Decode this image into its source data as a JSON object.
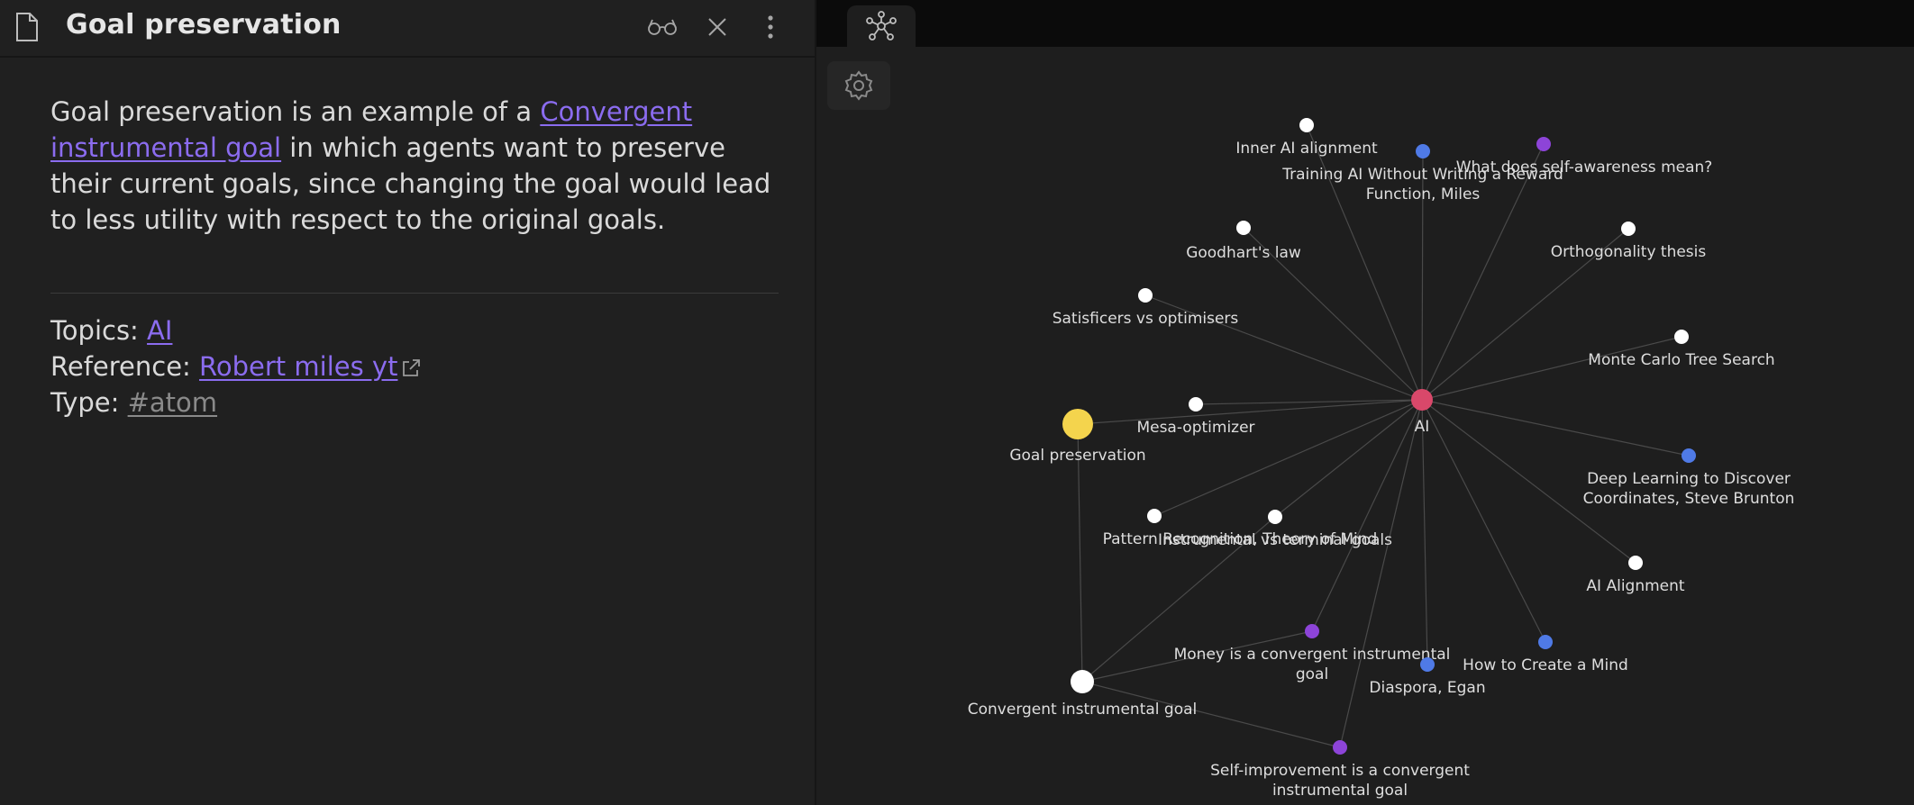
{
  "note": {
    "title": "Goal preservation",
    "header_icons": [
      "file-icon",
      "reading-view-icon",
      "close-icon",
      "more-options-icon"
    ],
    "paragraph": {
      "before_link": "Goal preservation is an example of a ",
      "link_line1": "Convergent ",
      "link_line2": "instrumental goal",
      "after_link": " in which agents want to preserve their current goals, since changing the goal would lead to less utility with respect to the original goals."
    },
    "topics_label": "Topics: ",
    "topics_link": "AI",
    "reference_label": "Reference: ",
    "reference_link": "Robert miles yt",
    "type_label": "Type: ",
    "type_tag": "#atom"
  },
  "graph": {
    "tab_icon": "graph-view-icon",
    "settings_icon": "gear-icon",
    "colors": {
      "background": "#1e1e1e",
      "edge": "#4a4a4a",
      "node_default": "#ffffff",
      "node_center": "#d9486a",
      "node_active": "#f4d44d",
      "node_blue": "#4f7ae6",
      "node_purple": "#8d44d8"
    },
    "nodes": [
      {
        "id": "ai",
        "label": "AI",
        "color": "node_center"
      },
      {
        "id": "goal-preservation",
        "label": "Goal preservation",
        "color": "node_active"
      },
      {
        "id": "convergent-instrumental-goal",
        "label": "Convergent instrumental goal",
        "color": "node_default"
      },
      {
        "id": "inner-ai-alignment",
        "label": "Inner AI alignment",
        "color": "node_default"
      },
      {
        "id": "training-ai-without-reward",
        "label_lines": [
          "Training AI Without Writing a Reward",
          "Function, Miles"
        ],
        "color": "node_blue"
      },
      {
        "id": "self-awareness",
        "label": "What does self-awareness mean?",
        "color": "node_purple"
      },
      {
        "id": "goodharts-law",
        "label": "Goodhart's law",
        "color": "node_default"
      },
      {
        "id": "orthogonality-thesis",
        "label": "Orthogonality thesis",
        "color": "node_default"
      },
      {
        "id": "satisficers",
        "label": "Satisficers vs optimisers",
        "color": "node_default"
      },
      {
        "id": "monte-carlo",
        "label": "Monte Carlo Tree Search",
        "color": "node_default"
      },
      {
        "id": "mesa-optimizer",
        "label": "Mesa-optimizer",
        "color": "node_default"
      },
      {
        "id": "deep-learning-coordinates",
        "label_lines": [
          "Deep Learning to Discover",
          "Coordinates, Steve Brunton"
        ],
        "color": "node_blue"
      },
      {
        "id": "pattern-recognition",
        "label": "Pattern Recognition, Theory of Mind",
        "color": "node_default"
      },
      {
        "id": "instrumental-terminal",
        "label": "Instrumental vs terminal goals",
        "color": "node_default"
      },
      {
        "id": "ai-alignment",
        "label": "AI Alignment",
        "color": "node_default"
      },
      {
        "id": "money",
        "label_lines": [
          "Money is a convergent instrumental",
          "goal"
        ],
        "color": "node_purple"
      },
      {
        "id": "diaspora",
        "label": "Diaspora, Egan",
        "color": "node_blue"
      },
      {
        "id": "how-to-create-mind",
        "label": "How to Create a Mind",
        "color": "node_blue"
      },
      {
        "id": "self-improvement",
        "label_lines": [
          "Self-improvement is a convergent",
          "instrumental goal"
        ],
        "color": "node_purple"
      }
    ],
    "edges": [
      [
        "ai",
        "inner-ai-alignment"
      ],
      [
        "ai",
        "training-ai-without-reward"
      ],
      [
        "ai",
        "self-awareness"
      ],
      [
        "ai",
        "goodharts-law"
      ],
      [
        "ai",
        "orthogonality-thesis"
      ],
      [
        "ai",
        "satisficers"
      ],
      [
        "ai",
        "monte-carlo"
      ],
      [
        "ai",
        "mesa-optimizer"
      ],
      [
        "ai",
        "goal-preservation"
      ],
      [
        "ai",
        "deep-learning-coordinates"
      ],
      [
        "ai",
        "pattern-recognition"
      ],
      [
        "ai",
        "instrumental-terminal"
      ],
      [
        "ai",
        "ai-alignment"
      ],
      [
        "ai",
        "money"
      ],
      [
        "ai",
        "diaspora"
      ],
      [
        "ai",
        "how-to-create-mind"
      ],
      [
        "ai",
        "self-improvement"
      ],
      [
        "goal-preservation",
        "convergent-instrumental-goal"
      ],
      [
        "convergent-instrumental-goal",
        "money"
      ],
      [
        "convergent-instrumental-goal",
        "self-improvement"
      ],
      [
        "convergent-instrumental-goal",
        "instrumental-terminal"
      ]
    ]
  }
}
